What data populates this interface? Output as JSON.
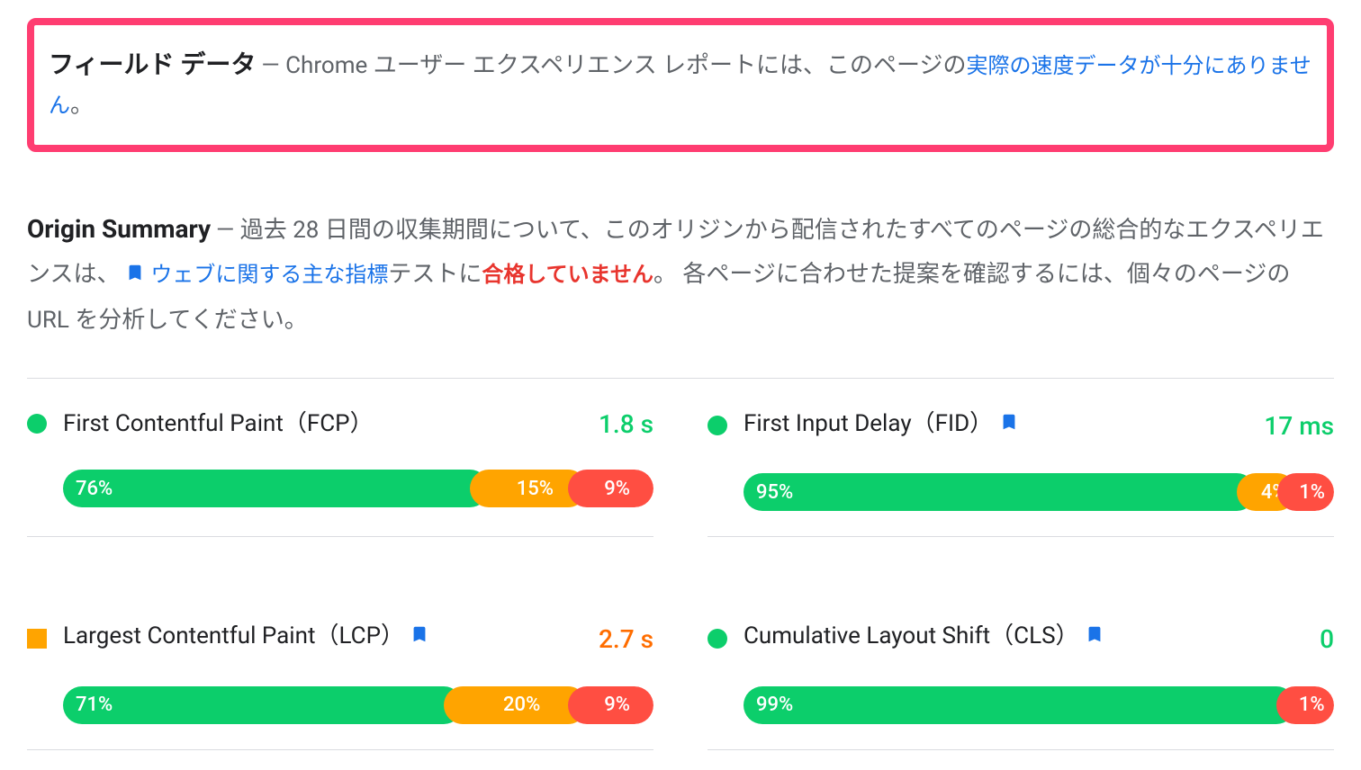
{
  "fieldData": {
    "title": "フィールド データ",
    "prefix": " — Chrome ユーザー エクスペリエンス レポートには、このページの",
    "link": "実際の速度データが十分にありません",
    "suffix": "。"
  },
  "originSummary": {
    "title": "Origin Summary",
    "prefix": " — 過去 28 日間の収集期間について、このオリジンから配信されたすべてのページの総合的なエクスペリエンスは、",
    "link": "ウェブに関する主な指標",
    "mid": "テストに",
    "fail": "合格していません",
    "suffix": "。 各ページに合わせた提案を確認するには、個々のページの URL を分析してください。"
  },
  "metrics": [
    {
      "name": "First Contentful Paint（FCP）",
      "status": "green",
      "shape": "dot",
      "value": "1.8 s",
      "valueColor": "green",
      "bookmark": false,
      "distribution": {
        "good": 76,
        "needs": 15,
        "poor": 9
      }
    },
    {
      "name": "First Input Delay（FID）",
      "status": "green",
      "shape": "dot",
      "value": "17 ms",
      "valueColor": "green",
      "bookmark": true,
      "distribution": {
        "good": 95,
        "needs": 4,
        "poor": 1
      }
    },
    {
      "name": "Largest Contentful Paint（LCP）",
      "status": "orange",
      "shape": "square",
      "value": "2.7 s",
      "valueColor": "orange",
      "bookmark": true,
      "distribution": {
        "good": 71,
        "needs": 20,
        "poor": 9
      }
    },
    {
      "name": "Cumulative Layout Shift（CLS）",
      "status": "green",
      "shape": "dot",
      "value": "0",
      "valueColor": "green",
      "bookmark": true,
      "distribution": {
        "good": 99,
        "needs": 0,
        "poor": 1
      }
    }
  ],
  "labels": {
    "pct": "%"
  }
}
